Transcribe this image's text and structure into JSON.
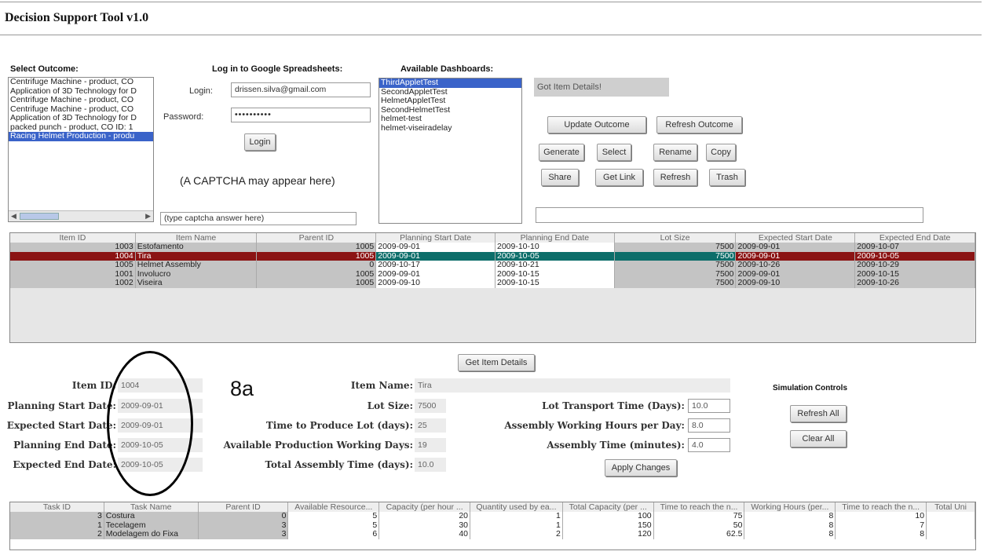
{
  "app": {
    "title": "Decision Support Tool v1.0"
  },
  "outcome": {
    "header": "Select Outcome:",
    "items": [
      "Centrifuge Machine - product, CO",
      "Application of 3D Technology for D",
      "Centrifuge Machine - product, CO",
      "Centrifuge Machine - product, CO",
      "Application of 3D Technology for D",
      "packed punch - product, CO ID: 1",
      "Racing Helmet Production - produ"
    ],
    "selected_index": 6
  },
  "login": {
    "header": "Log in to Google Spreadsheets:",
    "login_label": "Login:",
    "login_value": "drissen.silva@gmail.com",
    "password_label": "Password:",
    "password_value": "••••••••••",
    "button": "Login",
    "captcha_note": "(A CAPTCHA may appear here)",
    "captcha_placeholder": "(type captcha answer here)"
  },
  "dashboards": {
    "header": "Available Dashboards:",
    "items": [
      "ThirdAppletTest",
      "SecondAppletTest",
      "HelmetAppletTest",
      "SecondHelmetTest",
      "helmet-test",
      "helmet-viseiradelay"
    ],
    "selected_index": 0
  },
  "status": {
    "message": "Got Item Details!"
  },
  "actions": {
    "update_outcome": "Update Outcome",
    "refresh_outcome": "Refresh Outcome",
    "generate": "Generate",
    "select": "Select",
    "rename": "Rename",
    "copy": "Copy",
    "share": "Share",
    "get_link": "Get Link",
    "refresh": "Refresh",
    "trash": "Trash"
  },
  "items_table": {
    "columns": [
      "Item ID",
      "Item Name",
      "Parent ID",
      "Planning Start Date",
      "Planning End Date",
      "Lot Size",
      "Expected Start Date",
      "Expected End Date"
    ],
    "rows": [
      [
        "1003",
        "Estofamento",
        "1005",
        "2009-09-01",
        "2009-10-10",
        "7500",
        "2009-09-01",
        "2009-10-07"
      ],
      [
        "1004",
        "Tira",
        "1005",
        "2009-09-01",
        "2009-10-05",
        "7500",
        "2009-09-01",
        "2009-10-05"
      ],
      [
        "1005",
        "Helmet Assembly",
        "0",
        "2009-10-17",
        "2009-10-21",
        "7500",
        "2009-10-26",
        "2009-10-29"
      ],
      [
        "1001",
        "Involucro",
        "1005",
        "2009-09-01",
        "2009-10-15",
        "7500",
        "2009-09-01",
        "2009-10-15"
      ],
      [
        "1002",
        "Viseira",
        "1005",
        "2009-09-10",
        "2009-10-15",
        "7500",
        "2009-09-10",
        "2009-10-26"
      ]
    ],
    "selected_index": 1
  },
  "get_details_button": "Get Item Details",
  "annotation": "8a",
  "details": {
    "item_id_label": "Item ID:",
    "item_id": "1004",
    "planning_start_label": "Planning Start Date:",
    "planning_start": "2009-09-01",
    "expected_start_label": "Expected Start Date:",
    "expected_start": "2009-09-01",
    "planning_end_label": "Planning End Date:",
    "planning_end": "2009-10-05",
    "expected_end_label": "Expected End Date:",
    "expected_end": "2009-10-05",
    "item_name_label": "Item Name:",
    "item_name": "Tira",
    "lot_size_label": "Lot Size:",
    "lot_size": "7500",
    "time_to_produce_label": "Time to Produce Lot (days):",
    "time_to_produce": "25",
    "available_days_label": "Available Production Working Days:",
    "available_days": "19",
    "total_assembly_label": "Total Assembly Time (days):",
    "total_assembly": "10.0",
    "lot_transport_label": "Lot Transport Time (Days):",
    "lot_transport": "10.0",
    "assembly_hours_label": "Assembly Working Hours per Day:",
    "assembly_hours": "8.0",
    "assembly_time_label": "Assembly Time (minutes):",
    "assembly_time": "4.0",
    "apply_button": "Apply Changes"
  },
  "simulation": {
    "header": "Simulation Controls",
    "refresh_all": "Refresh All",
    "clear_all": "Clear All"
  },
  "tasks_table": {
    "columns": [
      "Task ID",
      "Task Name",
      "Parent ID",
      "Available Resource...",
      "Capacity (per hour ...",
      "Quantity used by ea...",
      "Total Capacity (per ...",
      "Time to reach the n...",
      "Working Hours (per...",
      "Time to reach the n...",
      "Total Uni"
    ],
    "rows": [
      [
        "3",
        "Costura",
        "0",
        "5",
        "20",
        "1",
        "100",
        "75",
        "8",
        "10",
        ""
      ],
      [
        "1",
        "Tecelagem",
        "3",
        "5",
        "30",
        "1",
        "150",
        "50",
        "8",
        "7",
        ""
      ],
      [
        "2",
        "Modelagem do Fixa",
        "3",
        "6",
        "40",
        "2",
        "120",
        "62.5",
        "8",
        "8",
        ""
      ]
    ]
  },
  "colors": {
    "selection_blue": "#3a63c9",
    "selected_row": "#8b1414",
    "selected_cell": "#0d6e6a",
    "status_bg": "#cfcfcf"
  }
}
